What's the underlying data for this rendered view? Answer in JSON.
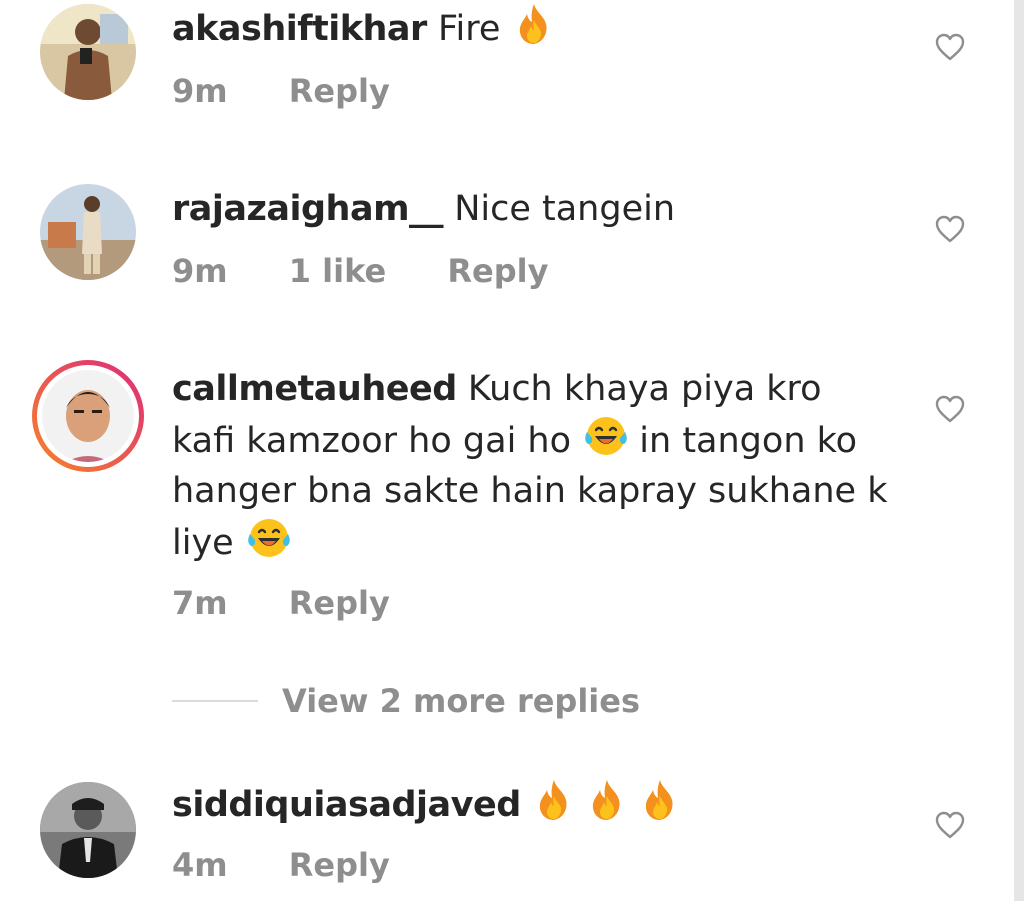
{
  "comments": [
    {
      "username": "akashiftikhar",
      "text": "Fire",
      "emoji": [
        "fire"
      ],
      "time": "9m",
      "reply": "Reply"
    },
    {
      "username": "rajazaigham__",
      "text": "Nice tangein",
      "time": "9m",
      "likes": "1 like",
      "reply": "Reply"
    },
    {
      "username": "callmetauheed",
      "text_part1": "Kuch khaya piya kro kafi kamzoor ho gai ho",
      "text_part2": "in tangon ko hanger bna sakte hain kapray sukhane k liye",
      "emoji": [
        "face-with-tears-of-joy",
        "face-with-tears-of-joy"
      ],
      "time": "7m",
      "reply": "Reply",
      "view_replies": "View 2 more replies"
    },
    {
      "username": "siddiquiasadjaved",
      "emoji": [
        "fire",
        "fire",
        "fire"
      ],
      "time": "4m",
      "reply": "Reply"
    }
  ],
  "colors": {
    "text": "#262626",
    "secondary": "#8e8e8e",
    "story_ring_start": "#f58529",
    "story_ring_end": "#dd2a7b"
  }
}
